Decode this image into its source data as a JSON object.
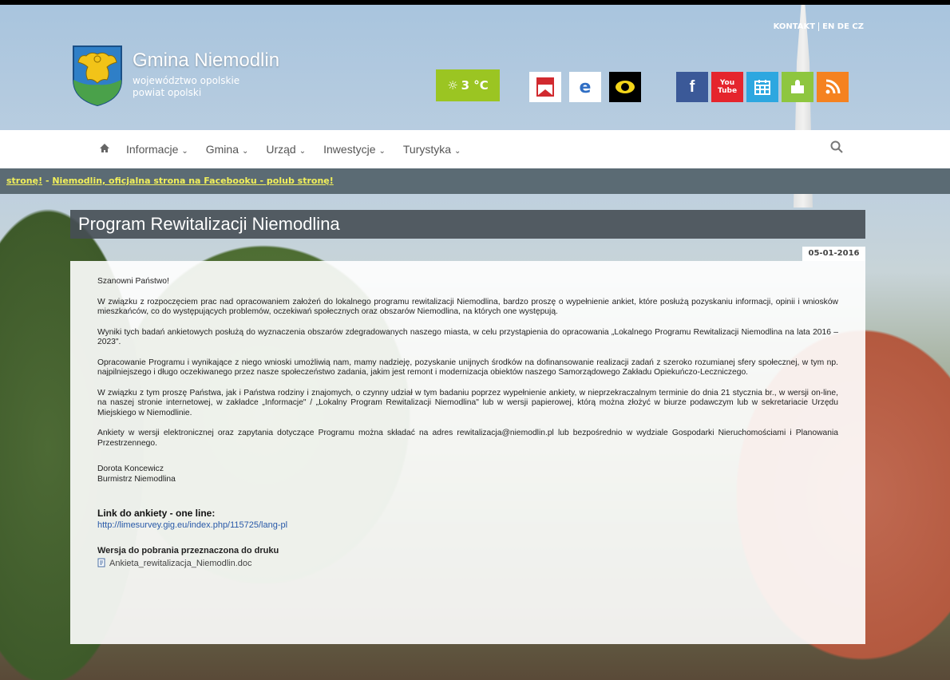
{
  "header": {
    "site_name": "Gmina Niemodlin",
    "voivodeship": "województwo opolskie",
    "county": "powiat opolski",
    "contact": "KONTAKT",
    "languages": "EN DE CZ",
    "weather_icon": "sun-icon",
    "weather": "3 °C",
    "icons": [
      {
        "name": "bip-icon",
        "color": "#ffffff"
      },
      {
        "name": "epuap-icon",
        "color": "#ffffff"
      },
      {
        "name": "accessibility-eye-icon",
        "color": "#000000"
      },
      {
        "name": "facebook-icon",
        "color": "#3b5998"
      },
      {
        "name": "youtube-icon",
        "color": "#e5252d"
      },
      {
        "name": "calendar-icon",
        "color": "#2da7e0"
      },
      {
        "name": "puzzle-icon",
        "color": "#8ec63f"
      },
      {
        "name": "rss-icon",
        "color": "#f58220"
      }
    ]
  },
  "nav": {
    "items": [
      "Informacje",
      "Gmina",
      "Urząd",
      "Inwestycje",
      "Turystyka"
    ]
  },
  "ticker": {
    "text_a": "stronę!",
    "sep": " - ",
    "text_b": "Niemodlin, oficjalna strona na Facebooku - polub stronę!"
  },
  "article": {
    "title": "Program Rewitalizacji Niemodlina",
    "date": "05-01-2016",
    "greeting": "Szanowni Państwo!",
    "p1": "W związku z rozpoczęciem prac nad opracowaniem założeń do lokalnego programu rewitalizacji Niemodlina, bardzo proszę o wypełnienie ankiet, które posłużą pozyskaniu informacji, opinii i wniosków mieszkańców, co do występujących problemów, oczekiwań społecznych oraz obszarów Niemodlina, na których one występują.",
    "p2": "Wyniki tych badań ankietowych posłużą do wyznaczenia obszarów zdegradowanych naszego miasta, w celu przystąpienia do opracowania „Lokalnego Programu Rewitalizacji Niemodlina na lata 2016 – 2023\".",
    "p3": "Opracowanie Programu i wynikające z niego wnioski umożliwią nam, mamy nadzieję, pozyskanie unijnych środków na dofinansowanie realizacji zadań z szeroko rozumianej sfery społecznej, w tym np. najpilniejszego i długo oczekiwanego przez nasze społeczeństwo zadania, jakim jest remont i modernizacja obiektów naszego Samorządowego Zakładu Opiekuńczo-Leczniczego.",
    "p4": "W związku z tym proszę Państwa, jak i Państwa rodziny i znajomych, o czynny udział w tym badaniu poprzez wypełnienie ankiety, w nieprzekraczalnym terminie do dnia 21 stycznia br., w wersji on-line, na naszej stronie internetowej, w zakładce „Informacje\" / „Lokalny Program Rewitalizacji Niemodlina\" lub w wersji papierowej, którą można złożyć w biurze podawczym lub w sekretariacie Urzędu Miejskiego w Niemodlinie.",
    "p5": "Ankiety w wersji elektronicznej oraz zapytania dotyczące Programu można składać na adres rewitalizacja@niemodlin.pl lub bezpośrednio w wydziale Gospodarki Nieruchomościami i Planowania Przestrzennego.",
    "sign_name": "Dorota Koncewicz",
    "sign_role": "Burmistrz Niemodlina",
    "link_title": "Link do ankiety - one line:",
    "link_url": "http://limesurvey.gig.eu/index.php/115725/lang-pl",
    "print_title": "Wersja do pobrania przeznaczona do druku",
    "file_name": "Ankieta_rewitalizacja_Niemodlin.doc"
  }
}
